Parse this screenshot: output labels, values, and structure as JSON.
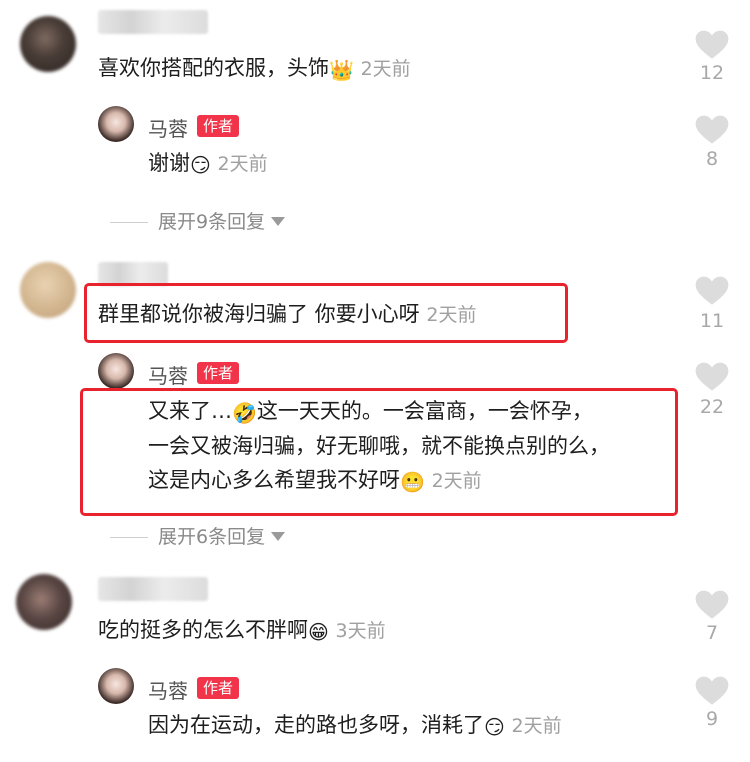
{
  "comments": [
    {
      "text": "喜欢你搭配的衣服，头饰",
      "emoji": "👑",
      "time": "2天前",
      "likes": "12",
      "reply": {
        "name": "马蓉",
        "badge": "作者",
        "text": "谢谢",
        "emoji": "😏",
        "time": "2天前",
        "likes": "8"
      },
      "expand": "展开9条回复"
    },
    {
      "text": "群里都说你被海归骗了 你要小心呀",
      "time": "2天前",
      "likes": "11",
      "reply": {
        "name": "马蓉",
        "badge": "作者",
        "line1_a": "又来了…",
        "line1_emoji": "🤣",
        "line1_b": "这一天天的。一会富商，一会怀孕，",
        "line2": "一会又被海归骗，好无聊哦，就不能换点别的么，",
        "line3": "这是内心多么希望我不好呀",
        "line3_emoji": "😬",
        "time": "2天前",
        "likes": "22"
      },
      "expand": "展开6条回复"
    },
    {
      "text": "吃的挺多的怎么不胖啊",
      "emoji": "😁",
      "time": "3天前",
      "likes": "7",
      "reply": {
        "name": "马蓉",
        "badge": "作者",
        "text": "因为在运动，走的路也多呀，消耗了",
        "emoji": "😏",
        "time": "2天前",
        "likes": "9"
      }
    }
  ]
}
